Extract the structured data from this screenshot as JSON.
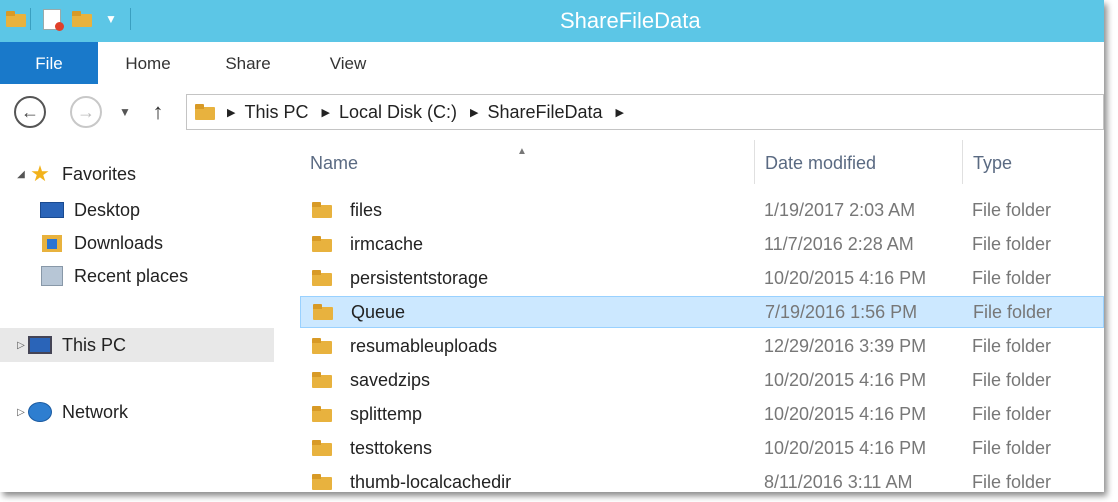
{
  "window": {
    "title": "ShareFileData"
  },
  "quick_access_toolbar": {
    "icons": [
      "folder-icon",
      "properties-icon",
      "new-folder-icon",
      "customize-dropdown-icon"
    ]
  },
  "ribbon": {
    "tabs": [
      {
        "label": "File",
        "active": true
      },
      {
        "label": "Home",
        "active": false
      },
      {
        "label": "Share",
        "active": false
      },
      {
        "label": "View",
        "active": false
      }
    ]
  },
  "navigation": {
    "back_icon": "back-arrow-icon",
    "forward_icon": "forward-arrow-icon",
    "recent_icon": "chevron-down-icon",
    "up_icon": "up-arrow-icon"
  },
  "address_bar": {
    "breadcrumbs": [
      "This PC",
      "Local Disk (C:)",
      "ShareFileData"
    ]
  },
  "nav_pane": {
    "items": [
      {
        "label": "Favorites",
        "icon": "star-icon",
        "expander": "expanded"
      },
      {
        "label": "Desktop",
        "icon": "desktop-icon"
      },
      {
        "label": "Downloads",
        "icon": "downloads-icon"
      },
      {
        "label": "Recent places",
        "icon": "recent-places-icon"
      },
      {
        "label": "This PC",
        "icon": "computer-icon",
        "expander": "collapsed",
        "selected": true
      },
      {
        "label": "Network",
        "icon": "network-icon",
        "expander": "collapsed"
      }
    ]
  },
  "file_list": {
    "columns": [
      "Name",
      "Date modified",
      "Type"
    ],
    "sort_indicator": "up",
    "rows": [
      {
        "name": "files",
        "date": "1/19/2017 2:03 AM",
        "type": "File folder"
      },
      {
        "name": "irmcache",
        "date": "11/7/2016 2:28 AM",
        "type": "File folder"
      },
      {
        "name": "persistentstorage",
        "date": "10/20/2015 4:16 PM",
        "type": "File folder"
      },
      {
        "name": "Queue",
        "date": "7/19/2016 1:56 PM",
        "type": "File folder",
        "selected": true
      },
      {
        "name": "resumableuploads",
        "date": "12/29/2016 3:39 PM",
        "type": "File folder"
      },
      {
        "name": "savedzips",
        "date": "10/20/2015 4:16 PM",
        "type": "File folder"
      },
      {
        "name": "splittemp",
        "date": "10/20/2015 4:16 PM",
        "type": "File folder"
      },
      {
        "name": "testtokens",
        "date": "10/20/2015 4:16 PM",
        "type": "File folder"
      },
      {
        "name": "thumb-localcachedir",
        "date": "8/11/2016 3:11 AM",
        "type": "File folder"
      }
    ]
  },
  "colors": {
    "title_bar": "#5cc6e6",
    "file_tab": "#1979ca",
    "selection": "#cce8ff",
    "folder": "#e8b23e"
  }
}
